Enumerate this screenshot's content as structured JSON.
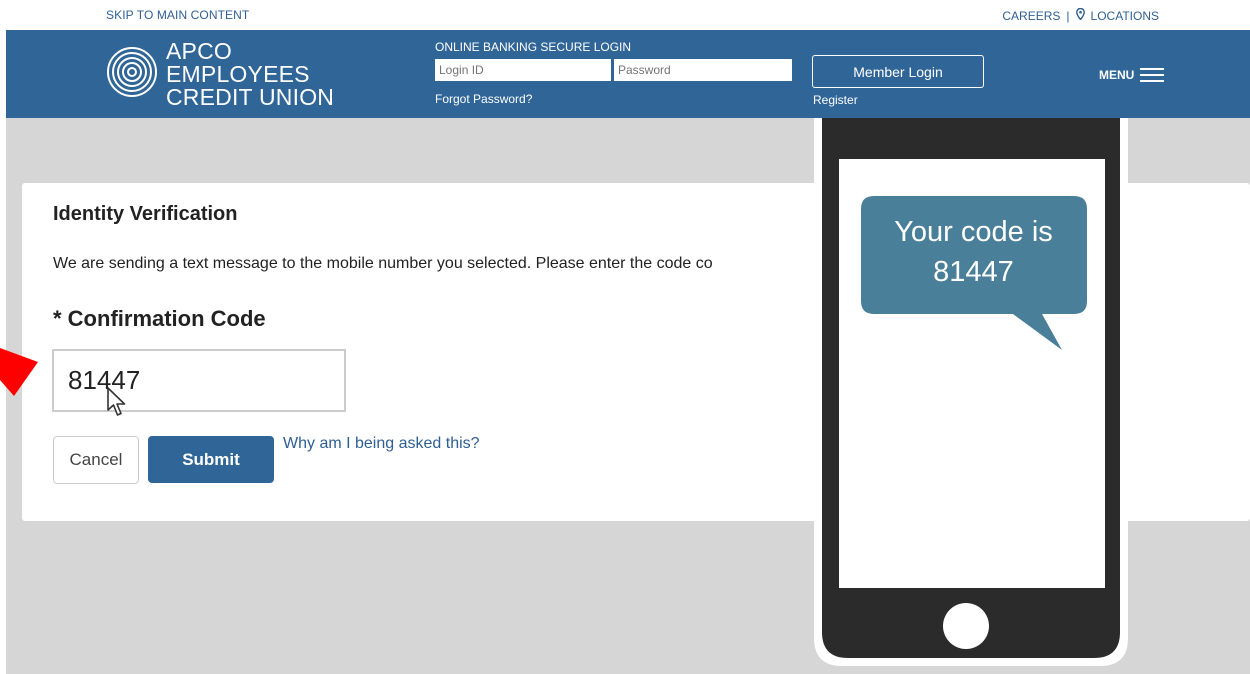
{
  "top": {
    "skip_link": "SKIP TO MAIN CONTENT",
    "careers": "CAREERS",
    "separator": "|",
    "locations": "LOCATIONS"
  },
  "header": {
    "logo_line1": "APCO EMPLOYEES",
    "logo_line2": "CREDIT UNION",
    "login_title": "ONLINE BANKING SECURE LOGIN",
    "login_id_placeholder": "Login ID",
    "password_placeholder": "Password",
    "forgot_password": "Forgot Password?",
    "member_login": "Member Login",
    "register": "Register",
    "menu": "MENU"
  },
  "verification": {
    "title": "Identity Verification",
    "description": "We are sending a text message to the mobile number you selected. Please enter the code co",
    "code_label": "* Confirmation Code",
    "code_value": "81447",
    "cancel": "Cancel",
    "submit": "Submit",
    "why_link": "Why am I being asked this?"
  },
  "phone": {
    "message_line1": "Your code is",
    "message_line2": "81447"
  },
  "colors": {
    "brand_blue": "#306597",
    "link_blue": "#2f5f92",
    "bubble": "#4a7f99",
    "phone_body": "#2b2b2b",
    "background_gray": "#d6d6d6",
    "arrow_red": "#ff0000"
  }
}
